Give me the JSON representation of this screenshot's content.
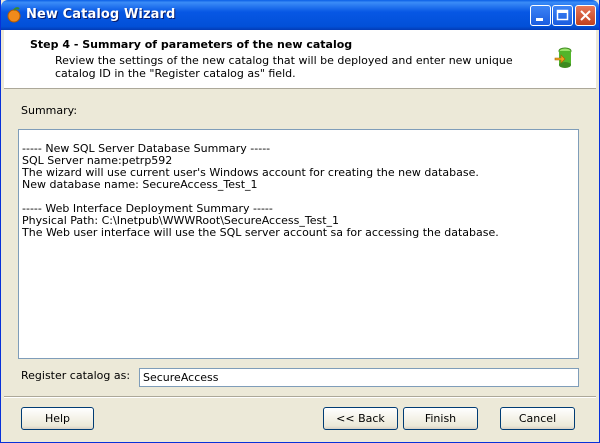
{
  "window": {
    "title": "New Catalog Wizard"
  },
  "header": {
    "step_title": "Step 4 - Summary of parameters of the new catalog",
    "description": "Review the settings of the new catalog that will be deployed and enter new unique catalog ID in the \"Register catalog as\" field."
  },
  "summary": {
    "label": "Summary:",
    "lines": [
      "----- New SQL Server Database Summary -----",
      "SQL Server name:petrp592",
      "The wizard will use current user's Windows account for creating the new database.",
      "New database name: SecureAccess_Test_1",
      "",
      "----- Web Interface Deployment Summary -----",
      "Physical Path: C:\\Inetpub\\WWWRoot\\SecureAccess_Test_1",
      "The Web user interface will use the SQL server account sa for accessing the database."
    ]
  },
  "register": {
    "label": "Register catalog as:",
    "value": "SecureAccess"
  },
  "buttons": {
    "help": "Help",
    "back": "<< Back",
    "finish": "Finish",
    "cancel": "Cancel"
  }
}
